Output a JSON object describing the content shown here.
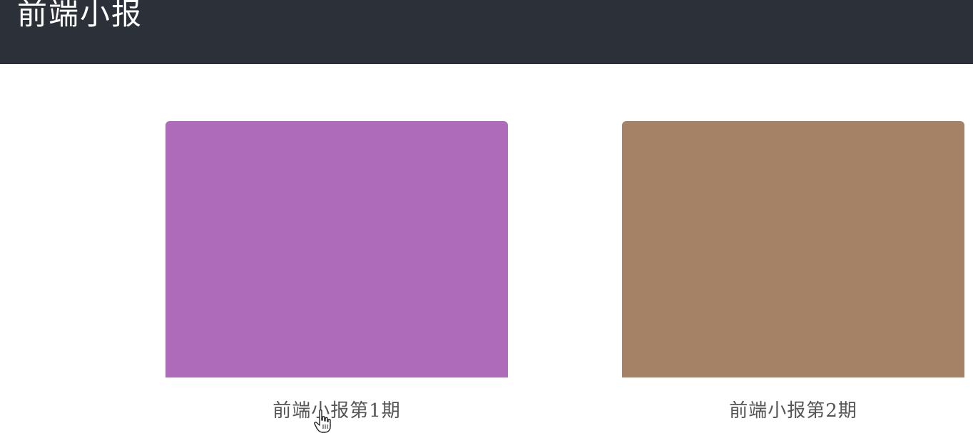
{
  "header": {
    "title": "前端小报",
    "background": "#2c3039"
  },
  "cards": [
    {
      "label": "前端小报第1期",
      "color": "#ae6bba"
    },
    {
      "label": "前端小报第2期",
      "color": "#a58266"
    }
  ],
  "cursor_icon": "hand-pointer-icon"
}
